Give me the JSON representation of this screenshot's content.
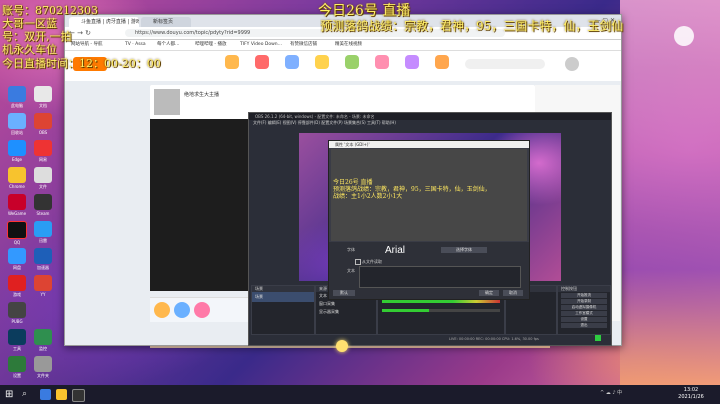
{
  "overlay": {
    "top_left_line1": "账号：870212303",
    "top_left_line2": "大哥一区蓝",
    "top_left_line3": "号：双开,一拍",
    "top_left_line4": "机永久车位",
    "top_left_line5": "今日直播时间：12：00-20：00",
    "top_center": "今日26号 直播",
    "top_right": "预测落鸽战绩：宗教，君神，95，三国卡特，仙，玉剑仙"
  },
  "browser": {
    "tabs": [
      {
        "label": "斗鱼直播 | 虎牙直播 | 游戏直播"
      },
      {
        "label": "新标签页"
      }
    ],
    "url": "https://www.douyu.com/topic/pdyty?rid=9999",
    "bookmarks": [
      "网站导航 - 导航",
      "TV · Assa",
      "每个人都…",
      "哔哩哔哩 - 播放",
      "TIFY Video Down…",
      "有赞微信店铺",
      "精美在线视频"
    ],
    "streamer_name": "绝地求生大主播"
  },
  "obs": {
    "title": "OBS 26.1.2 (64-bit, windows) - 配置文件: 未命名 - 场景: 未命名",
    "menu": "文件(F)  编辑(E)  视图(V)  停靠部件(D)  配置文件(P)  场景集合(S)  工具(T)  帮助(H)",
    "docks": [
      "场景",
      "来源",
      "混音器",
      "场景过渡",
      "控制按钮"
    ],
    "scene_item": "场景",
    "source_items": [
      "文本",
      "窗口采集",
      "显示器采集"
    ],
    "controls": [
      "开始推流",
      "开始录制",
      "启动虚拟摄像机",
      "工作室模式",
      "设置",
      "退出"
    ],
    "status": "LIVE: 00:00:00  REC: 00:00:00  CPU: 1.6%, 30.00 fps"
  },
  "text_dialog": {
    "title": "属性 '文本 (GDI+)'",
    "preview_text": "今日26号 直播\n预测落鸽战绩：宗教，君神，95，三国卡特，仙，玉剑仙，\n战绩：主1小2人数2小1大",
    "font_label": "字体",
    "font_value": "Arial",
    "font_button": "选择字体",
    "text_label": "文本",
    "from_file_label": "从文件读取",
    "ok": "确定",
    "cancel": "取消",
    "defaults": "默认"
  },
  "taskbar": {
    "time": "13:02",
    "date": "2021/1/26"
  }
}
